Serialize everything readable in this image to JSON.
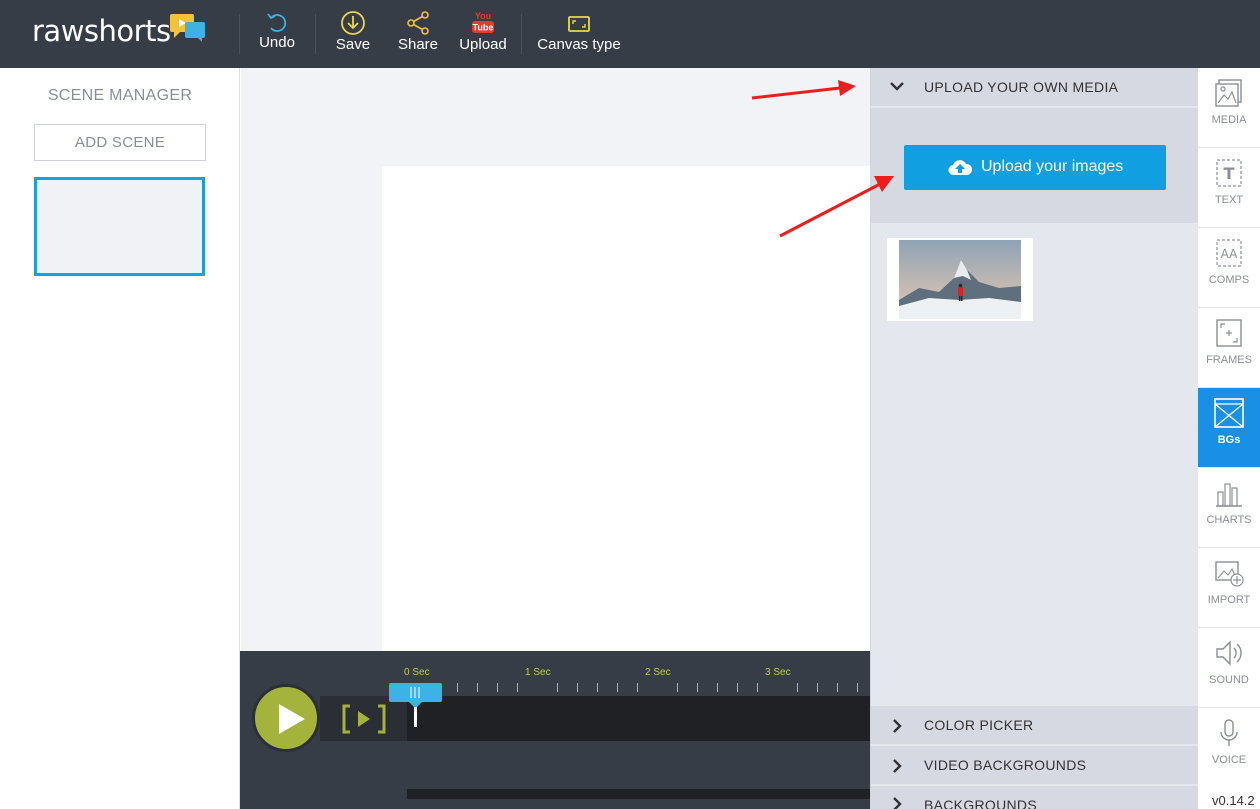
{
  "app": {
    "logo_prefix": "raw",
    "logo_suffix": "shorts",
    "accent": "#a4b33c",
    "brand_blue": "#109fe0"
  },
  "toolbar": {
    "undo": "Undo",
    "save": "Save",
    "share": "Share",
    "upload": "Upload",
    "upload_badge_top": "You",
    "upload_badge_bottom": "Tube",
    "canvas_type": "Canvas type"
  },
  "scene_manager": {
    "title": "SCENE MANAGER",
    "add_scene": "ADD SCENE"
  },
  "timeline": {
    "seconds": [
      "0 Sec",
      "1 Sec",
      "2 Sec",
      "3 Sec"
    ]
  },
  "media_panel": {
    "upload_section": "UPLOAD YOUR OWN MEDIA",
    "upload_button": "Upload your images",
    "sections": [
      "COLOR PICKER",
      "VIDEO BACKGROUNDS",
      "BACKGROUNDS"
    ]
  },
  "rail": {
    "items": [
      {
        "label": "MEDIA",
        "icon": "image-icon"
      },
      {
        "label": "TEXT",
        "icon": "text-icon"
      },
      {
        "label": "COMPS",
        "icon": "comps-icon"
      },
      {
        "label": "FRAMES",
        "icon": "frames-icon"
      },
      {
        "label": "BGs",
        "icon": "background-icon"
      },
      {
        "label": "CHARTS",
        "icon": "chart-icon"
      },
      {
        "label": "IMPORT",
        "icon": "import-icon"
      },
      {
        "label": "SOUND",
        "icon": "sound-icon"
      },
      {
        "label": "VOICE",
        "icon": "microphone-icon"
      }
    ],
    "active": "BGs",
    "version": "v0.14.2"
  }
}
